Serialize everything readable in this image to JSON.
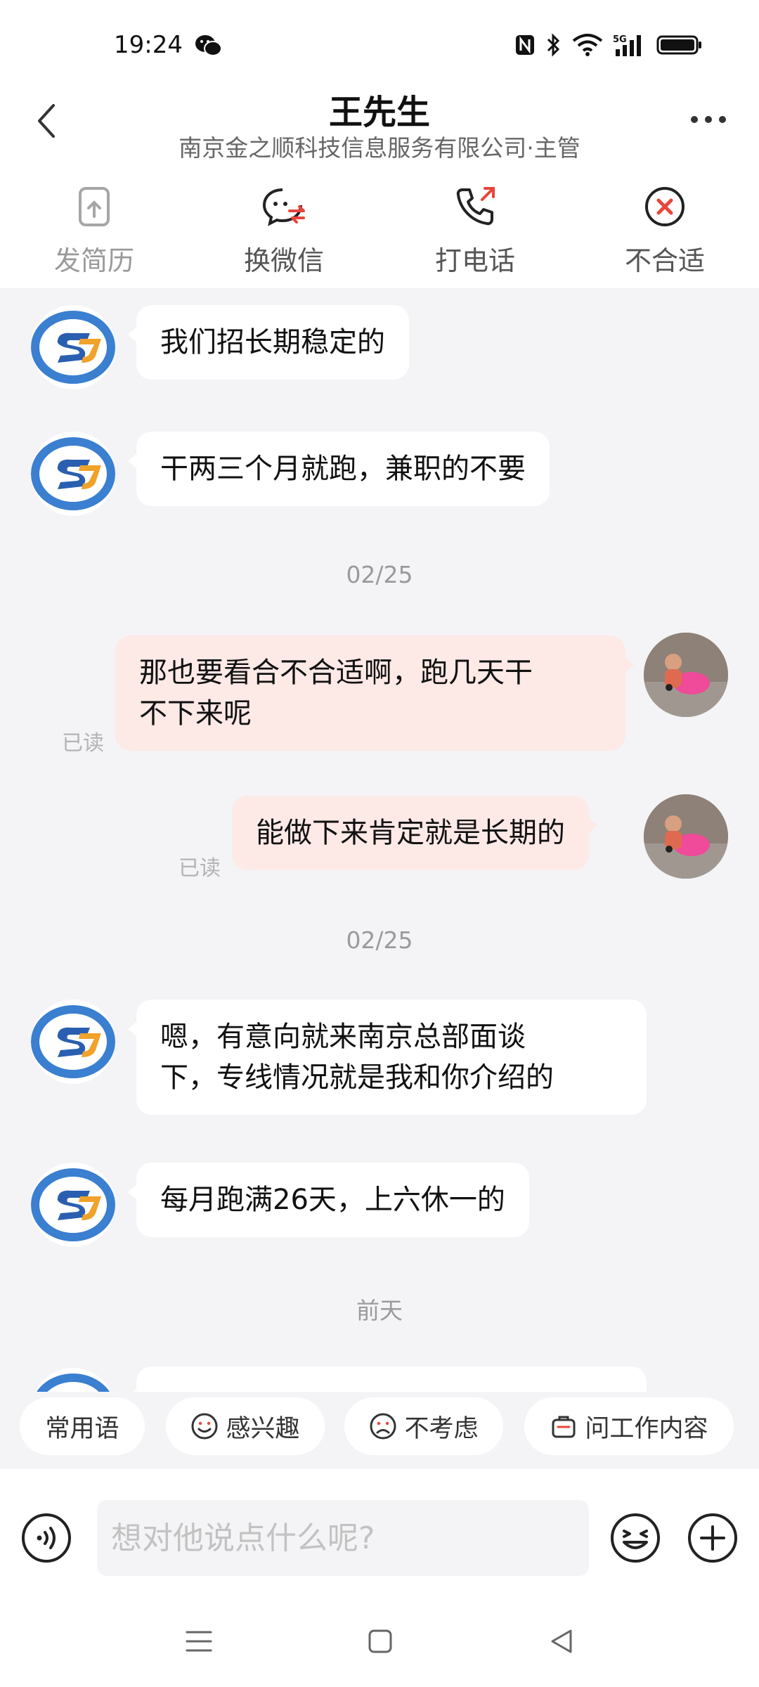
{
  "status_bar": {
    "time": "19:24",
    "icons": [
      "wechat-icon",
      "nfc-icon",
      "bluetooth-icon",
      "wifi-icon",
      "5g-signal-icon",
      "battery-icon"
    ]
  },
  "header": {
    "name": "王先生",
    "subtitle": "南京金之顺科技信息服务有限公司·主管"
  },
  "actions": [
    {
      "label": "发简历",
      "icon": "send-resume-icon",
      "enabled": false
    },
    {
      "label": "换微信",
      "icon": "exchange-wechat-icon",
      "enabled": true
    },
    {
      "label": "打电话",
      "icon": "phone-call-icon",
      "enabled": true
    },
    {
      "label": "不合适",
      "icon": "reject-icon",
      "enabled": true
    }
  ],
  "messages": [
    {
      "from": "them",
      "text": "我们招长期稳定的"
    },
    {
      "from": "them",
      "text": "干两三个月就跑，兼职的不要"
    },
    {
      "type": "date",
      "text": "02/25"
    },
    {
      "from": "me",
      "lines": [
        "那也要看合不合适啊，跑几天干",
        "不下来呢"
      ],
      "status": "已读"
    },
    {
      "from": "me",
      "text": "能做下来肯定就是长期的",
      "status": "已读"
    },
    {
      "type": "date",
      "text": "02/25"
    },
    {
      "from": "them",
      "lines": [
        "嗯，有意向就来南京总部面谈",
        "下，专线情况就是我和你介绍的"
      ]
    },
    {
      "from": "them",
      "text": "每月跑满26天，上六休一的"
    },
    {
      "type": "date",
      "text": "前天"
    }
  ],
  "quick_replies": [
    {
      "label": "常用语",
      "icon": null
    },
    {
      "label": "感兴趣",
      "icon": "smile-icon"
    },
    {
      "label": "不考虑",
      "icon": "frown-icon"
    },
    {
      "label": "问工作内容",
      "icon": "briefcase-icon"
    }
  ],
  "input": {
    "placeholder": "想对他说点什么呢?",
    "value": ""
  },
  "colors": {
    "accent": "#e8463a",
    "chat_bg": "#f4f4f6",
    "outgoing_bubble": "#fde9e6",
    "incoming_bubble": "#ffffff"
  }
}
